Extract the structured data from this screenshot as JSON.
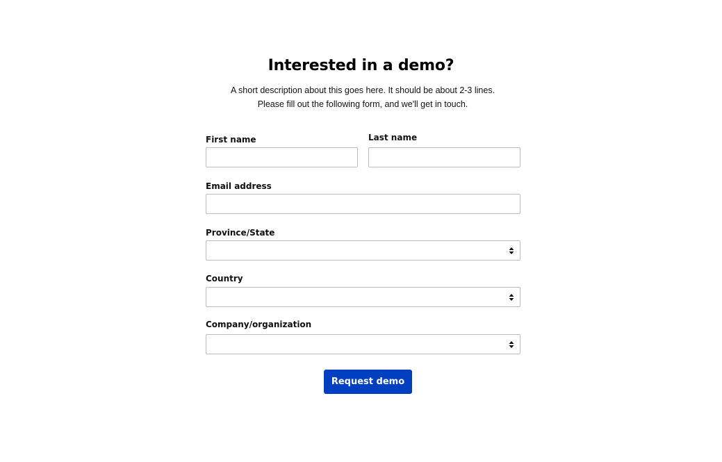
{
  "form": {
    "title": "Interested in a demo?",
    "description_line1": "A short description about this goes here. It should be about 2-3 lines.",
    "description_line2": "Please fill out the following form, and we'll get in touch.",
    "first_name": {
      "label": "First name",
      "value": ""
    },
    "last_name": {
      "label": "Last name",
      "value": ""
    },
    "email": {
      "label": "Email address",
      "value": ""
    },
    "province": {
      "label": "Province/State",
      "selected": ""
    },
    "country": {
      "label": "Country",
      "selected": ""
    },
    "company": {
      "label": "Company/organization",
      "selected": ""
    },
    "submit_label": "Request demo"
  },
  "icons": {
    "select_indicator": "updown-arrows-icon"
  },
  "colors": {
    "button_bg": "#0040c0",
    "button_text": "#ffffff",
    "input_border": "#b9bcc6"
  }
}
